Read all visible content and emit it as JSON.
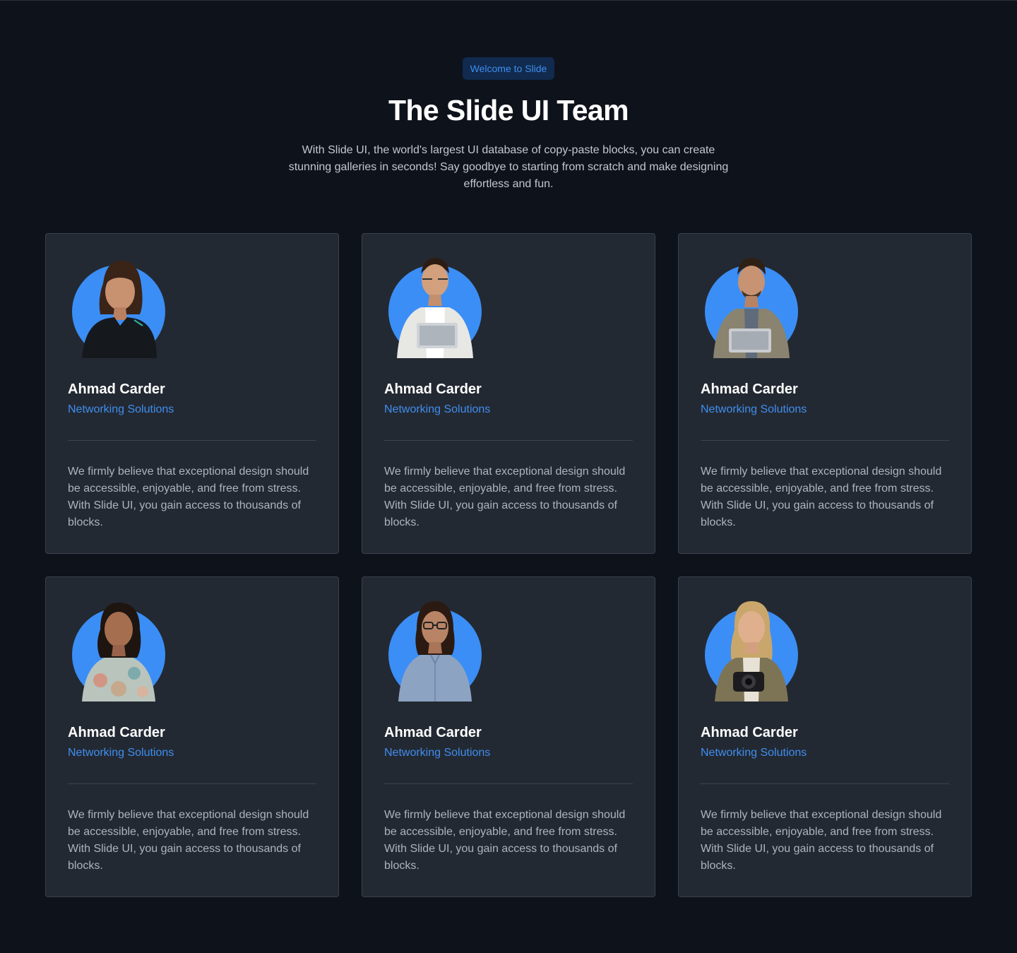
{
  "header": {
    "badge": "Welcome to Slide",
    "title": "The Slide UI Team",
    "subtitle": "With Slide UI, the world's largest UI database of copy-paste blocks, you can create stunning galleries in seconds! Say goodbye to starting from scratch and make designing effortless and fun."
  },
  "colors": {
    "background": "#0e121b",
    "card": "#232932",
    "accent": "#3f8ef0",
    "avatar_bg": "#3b8ef5"
  },
  "team": [
    {
      "name": "Ahmad Carder",
      "role": "Networking Solutions",
      "bio": "We firmly believe that exceptional design should be accessible, enjoyable, and free from stress. With Slide UI, you gain access to thousands of blocks.",
      "avatar_icon": "woman-portrait"
    },
    {
      "name": "Ahmad Carder",
      "role": "Networking Solutions",
      "bio": "We firmly believe that exceptional design should be accessible, enjoyable, and free from stress. With Slide UI, you gain access to thousands of blocks.",
      "avatar_icon": "man-with-laptop-portrait"
    },
    {
      "name": "Ahmad Carder",
      "role": "Networking Solutions",
      "bio": "We firmly believe that exceptional design should be accessible, enjoyable, and free from stress. With Slide UI, you gain access to thousands of blocks.",
      "avatar_icon": "man-with-laptop-portrait"
    },
    {
      "name": "Ahmad Carder",
      "role": "Networking Solutions",
      "bio": "We firmly believe that exceptional design should be accessible, enjoyable, and free from stress. With Slide UI, you gain access to thousands of blocks.",
      "avatar_icon": "woman-portrait"
    },
    {
      "name": "Ahmad Carder",
      "role": "Networking Solutions",
      "bio": "We firmly believe that exceptional design should be accessible, enjoyable, and free from stress. With Slide UI, you gain access to thousands of blocks.",
      "avatar_icon": "woman-with-glasses-portrait"
    },
    {
      "name": "Ahmad Carder",
      "role": "Networking Solutions",
      "bio": "We firmly believe that exceptional design should be accessible, enjoyable, and free from stress. With Slide UI, you gain access to thousands of blocks.",
      "avatar_icon": "woman-with-camera-portrait"
    }
  ]
}
